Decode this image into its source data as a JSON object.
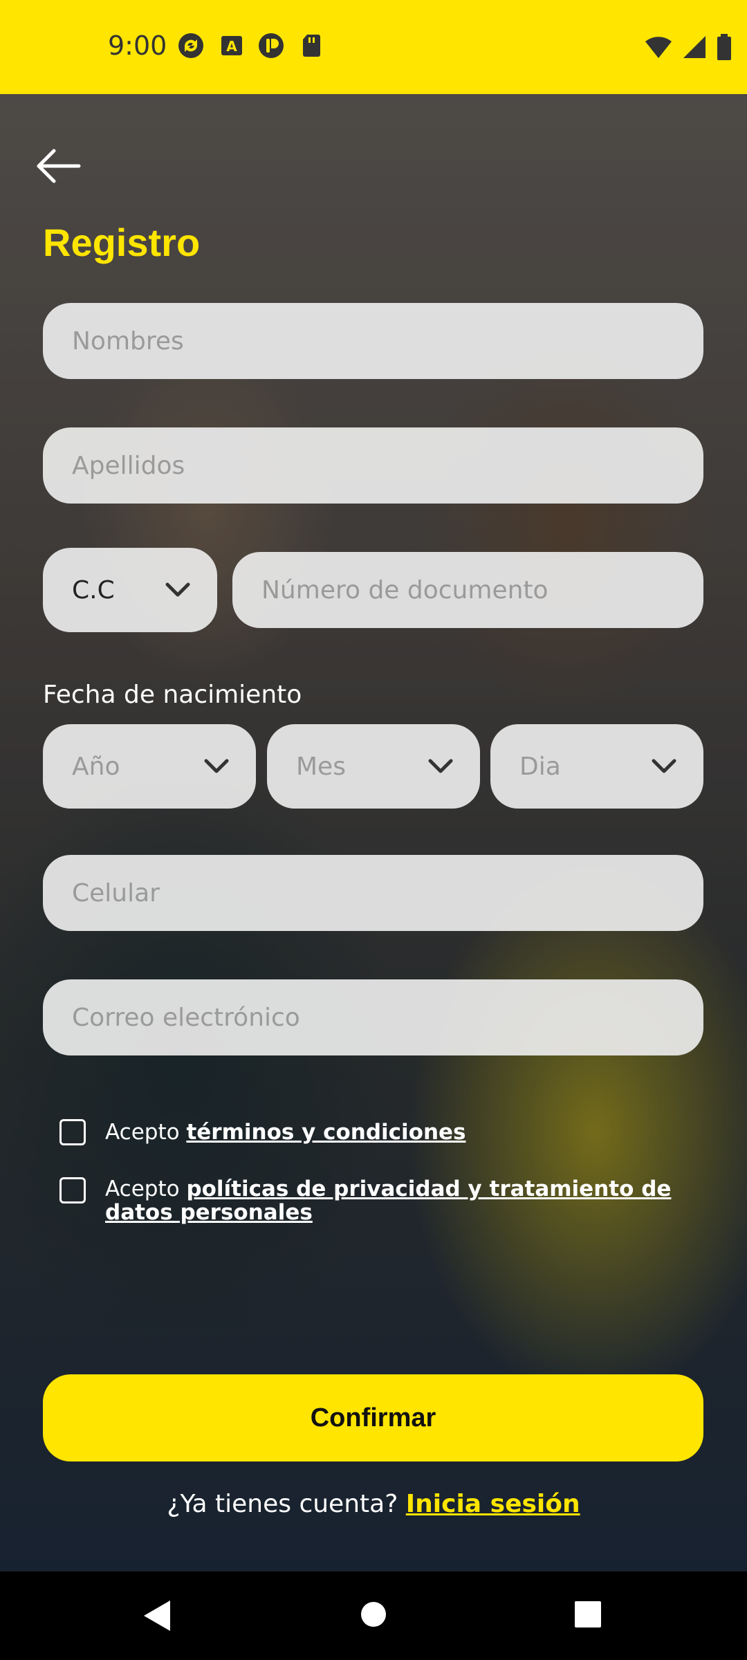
{
  "status_bar": {
    "time": "9:00",
    "icons_left": [
      "sync-icon",
      "text-a-icon",
      "pocket-icon",
      "sd-card-icon"
    ],
    "icons_right": [
      "wifi-icon",
      "signal-icon",
      "battery-icon"
    ],
    "color": "#ffe500"
  },
  "header": {
    "back_icon": "arrow-left-icon",
    "title": "Registro"
  },
  "form": {
    "nombres_placeholder": "Nombres",
    "apellidos_placeholder": "Apellidos",
    "doc_type_value": "C.C",
    "doc_number_placeholder": "Número de documento",
    "birth_label": "Fecha de nacimiento",
    "year_placeholder": "Año",
    "month_placeholder": "Mes",
    "day_placeholder": "Dia",
    "phone_placeholder": "Celular",
    "email_placeholder": "Correo electrónico"
  },
  "consents": {
    "terms_prefix": "Acepto",
    "terms_link": "términos y condiciones",
    "privacy_prefix": "Acepto",
    "privacy_link": "políticas de privacidad y tratamiento de datos personales"
  },
  "actions": {
    "confirm_label": "Confirmar",
    "login_prompt": "¿Ya tienes cuenta?",
    "login_link": "Inicia sesión"
  },
  "nav": {
    "back": "nav-back-icon",
    "home": "nav-home-icon",
    "recents": "nav-recents-icon"
  },
  "colors": {
    "accent": "#ffe500",
    "field_bg": "#ebebeb",
    "placeholder": "#9a9a9a"
  }
}
